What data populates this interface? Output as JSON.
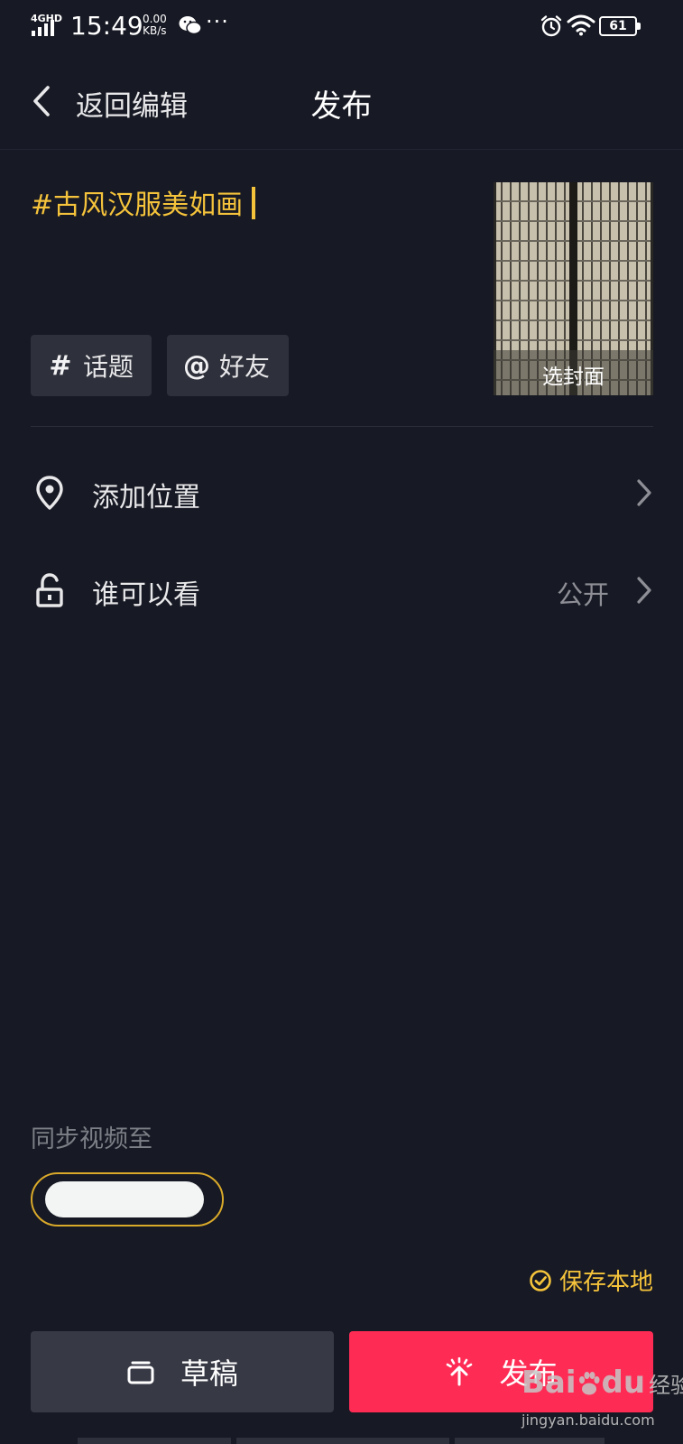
{
  "status_bar": {
    "network": "4GHD",
    "time": "15:49",
    "speed_value": "0.00",
    "speed_unit": "KB/s",
    "more": "···",
    "battery": "61"
  },
  "nav": {
    "back_label": "返回编辑",
    "title": "发布"
  },
  "caption": {
    "text": "#古风汉服美如画"
  },
  "chips": {
    "topic_icon": "#",
    "topic_label": "话题",
    "friend_icon": "@",
    "friend_label": "好友"
  },
  "cover": {
    "label": "选封面"
  },
  "options": {
    "location_label": "添加位置",
    "visibility_label": "谁可以看",
    "visibility_value": "公开"
  },
  "sync": {
    "label": "同步视频至"
  },
  "save_local": {
    "label": "保存本地"
  },
  "buttons": {
    "draft_label": "草稿",
    "publish_label": "发布"
  },
  "watermark": {
    "brand": "Bai",
    "brand_mid": "du",
    "brand_sub": "经验",
    "url": "jingyan.baidu.com"
  },
  "colors": {
    "background": "#171924",
    "accent_yellow": "#f5c33b",
    "publish_red": "#fe2c55",
    "chip_bg": "#2e303b"
  }
}
